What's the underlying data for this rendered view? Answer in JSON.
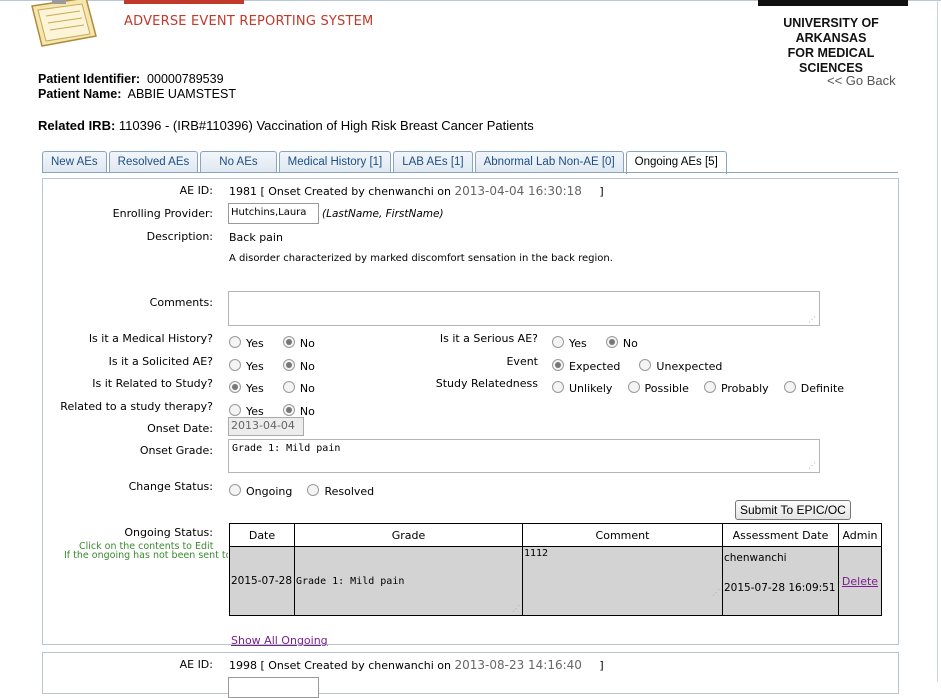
{
  "header": {
    "system_name": "ADVERSE EVENT REPORTING SYSTEM",
    "univ_line1": "UNIVERSITY OF ARKANSAS",
    "univ_line2": "FOR MEDICAL SCIENCES"
  },
  "patient": {
    "id_label": "Patient Identifier:",
    "id_value": "00000789539",
    "name_label": "Patient Name:",
    "name_value": "ABBIE UAMSTEST"
  },
  "go_back": "<< Go Back",
  "irb": {
    "label": "Related IRB:",
    "value": "110396  - (IRB#110396) Vaccination of High Risk Breast Cancer Patients"
  },
  "tabs": [
    {
      "label": "New AEs"
    },
    {
      "label": "Resolved AEs"
    },
    {
      "label": "No AEs"
    },
    {
      "label": "Medical History [1]"
    },
    {
      "label": "LAB AEs [1]"
    },
    {
      "label": "Abnormal Lab Non-AE [0]"
    },
    {
      "label": "Ongoing AEs [5]",
      "active": true
    }
  ],
  "ae1": {
    "id_label": "AE ID:",
    "id_value": "1981 [ Onset Created by chenwanchi on",
    "created_at": "2013-04-04 16:30:18",
    "id_close": "]",
    "provider_label": "Enrolling Provider:",
    "provider_value": "Hutchins,Laura",
    "provider_hint": "(LastName, FirstName)",
    "description_label": "Description:",
    "description_value": "Back pain",
    "description_detail": "A disorder characterized by marked discomfort sensation in the back region.",
    "comments_label": "Comments:",
    "comments_value": "",
    "medical_history_label": "Is it a Medical History?",
    "solicited_label": "Is it a Solicited AE?",
    "related_label": "Is it Related to Study?",
    "therapy_label": "Related to a study therapy?",
    "serious_label": "Is it a Serious AE?",
    "event_label": "Event",
    "relatedness_label": "Study Relatedness",
    "yes": "Yes",
    "no": "No",
    "expected": "Expected",
    "unexpected": "Unexpected",
    "unlikely": "Unlikely",
    "possible": "Possible",
    "probably": "Probably",
    "definite": "Definite",
    "onset_date_label": "Onset Date:",
    "onset_date_value": "2013-04-04",
    "onset_grade_label": "Onset Grade:",
    "onset_grade_value": "Grade 1: Mild pain",
    "change_status_label": "Change Status:",
    "ongoing": "Ongoing",
    "resolved": "Resolved",
    "submit_label": "Submit To EPIC/OC",
    "ongoing_status_label": "Ongoing Status:",
    "hint_line1": "Click on the contents to Edit",
    "hint_line2": "If the ongoing has not been sent to",
    "table": {
      "headers": [
        "Date",
        "Grade",
        "Comment",
        "Assessment Date",
        "Admin"
      ],
      "row": {
        "date": "2015-07-28",
        "grade": "Grade 1: Mild pain",
        "comment": "1112",
        "assessor": "chenwanchi",
        "assessment_date": "2015-07-28 16:09:51",
        "admin": "Delete"
      }
    },
    "show_all": "Show All Ongoing"
  },
  "ae2": {
    "id_label": "AE ID:",
    "id_value": "1998 [ Onset Created by chenwanchi on",
    "created_at": "2013-08-23 14:16:40",
    "id_close": "]"
  }
}
